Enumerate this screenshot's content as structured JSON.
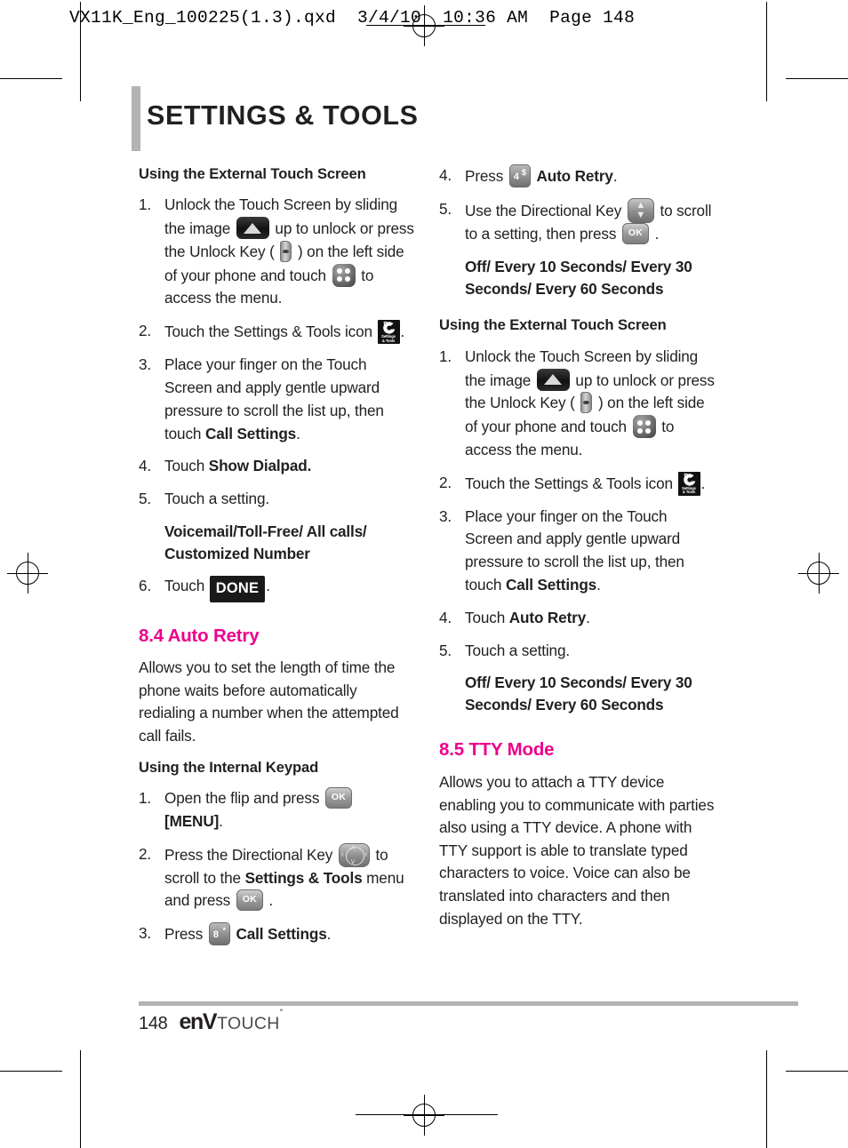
{
  "print_header": "VX11K_Eng_100225(1.3).qxd  3/4/10  10:36 AM  Page 148",
  "page_title": "SETTINGS & TOOLS",
  "colors": {
    "accent_pink": "#ec008c",
    "rule_gray": "#b3b3b3",
    "text": "#231f20"
  },
  "left_column": {
    "heading_1": "Using the External Touch Screen",
    "steps_1": {
      "n1": "1.",
      "n2": "2.",
      "n3": "3.",
      "n4": "4.",
      "n5": "5.",
      "n6": "6.",
      "s1_a": "Unlock the Touch Screen by sliding the image",
      "s1_b": "up to unlock or press the Unlock Key (",
      "s1_c": ") on the left side of your phone and touch",
      "s1_d": "to access the menu.",
      "s2_a": "Touch the Settings & Tools icon",
      "s2_b": ".",
      "s3_a": "Place your finger on the Touch Screen and apply gentle upward pressure to scroll the list up, then touch",
      "s3_b": "Call Settings",
      "s3_c": ".",
      "s4_a": "Touch",
      "s4_b": "Show Dialpad.",
      "s5_a": "Touch a setting.",
      "options_1": "Voicemail/Toll-Free/ All calls/ Customized Number",
      "s6_a": "Touch",
      "s6_done": "DONE",
      "s6_b": "."
    },
    "section": {
      "number_title": "8.4 Auto Retry",
      "body": "Allows you to set the length of time the phone waits before automatically redialing a number when the attempted call fails."
    },
    "heading_2": "Using the Internal Keypad",
    "steps_2": {
      "n1": "1.",
      "n2": "2.",
      "n3": "3.",
      "k1_a": "Open the flip and press",
      "k1_b": "[MENU]",
      "k1_c": ".",
      "k2_a": "Press the Directional Key",
      "k2_b": "to scroll to the",
      "k2_c": "Settings & Tools",
      "k2_d": "menu and press",
      "k2_e": ".",
      "k3_a": "Press",
      "k3_b": "Call Settings",
      "k3_c": "."
    }
  },
  "right_column": {
    "steps_cont": {
      "n4": "4.",
      "n5": "5.",
      "c4_a": "Press",
      "c4_b": "Auto Retry",
      "c4_c": ".",
      "c5_a": "Use the Directional Key",
      "c5_b": "to scroll to a setting, then press",
      "c5_c": ".",
      "options": "Off/ Every 10 Seconds/ Every 30 Seconds/ Every 60 Seconds"
    },
    "heading_1": "Using the External Touch Screen",
    "steps_1": {
      "n1": "1.",
      "n2": "2.",
      "n3": "3.",
      "n4": "4.",
      "n5": "5.",
      "s1_a": "Unlock the Touch Screen by sliding the image",
      "s1_b": "up to unlock or press the Unlock Key (",
      "s1_c": ") on the left side of your phone and touch",
      "s1_d": "to access the menu.",
      "s2_a": "Touch the Settings & Tools icon",
      "s2_b": ".",
      "s3_a": "Place your finger on the Touch Screen and apply gentle upward pressure to scroll the list up, then touch",
      "s3_b": "Call Settings",
      "s3_c": ".",
      "s4_a": "Touch",
      "s4_b": "Auto Retry",
      "s4_c": ".",
      "s5_a": "Touch a setting.",
      "options": "Off/ Every 10 Seconds/ Every 30 Seconds/ Every 60 Seconds"
    },
    "section": {
      "number_title": "8.5 TTY Mode",
      "body": "Allows you to attach a TTY device enabling you to communicate with parties also using a TTY device. A phone with TTY support is able to translate typed characters to voice. Voice can also be translated into characters and then displayed on the TTY."
    }
  },
  "icons": {
    "ok_key_label": "OK",
    "key_8_digit": "8",
    "key_8_symbol": "*",
    "key_4_digit": "4",
    "key_4_symbol": "$",
    "stools_label_1": "Settings",
    "stools_label_2": "& Tools",
    "dpad_left": "‹",
    "dpad_right": "›",
    "dpad_up": "˄",
    "dpad_down": "˅",
    "dpadv_up": "▲",
    "dpadv_down": "▼"
  },
  "footer": {
    "page_number": "148",
    "logo_env": "enV",
    "logo_tm": "°",
    "logo_touch": "TOUCH"
  }
}
